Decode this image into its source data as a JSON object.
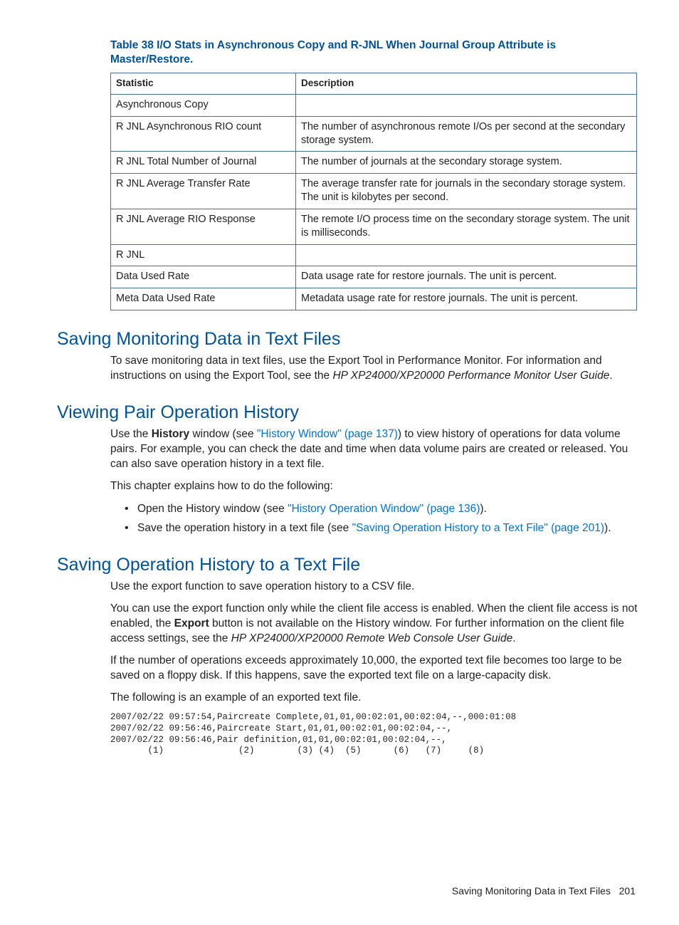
{
  "table": {
    "caption": "Table 38 I/O Stats in Asynchronous Copy and R-JNL When Journal Group Attribute is Master/Restore.",
    "headers": {
      "col1": "Statistic",
      "col2": "Description"
    },
    "rows": [
      {
        "c1": "Asynchronous Copy",
        "c2": ""
      },
      {
        "c1": "R JNL Asynchronous RIO count",
        "c2": "The number of asynchronous remote I/Os per second at the secondary storage system."
      },
      {
        "c1": "R JNL Total Number of Journal",
        "c2": "The number of journals at the secondary storage system."
      },
      {
        "c1": "R JNL Average Transfer Rate",
        "c2": "The average transfer rate for journals in the secondary storage system. The unit is kilobytes per second."
      },
      {
        "c1": "R JNL Average RIO Response",
        "c2": "The remote I/O process time on the secondary storage system. The unit is milliseconds."
      },
      {
        "c1": "R JNL",
        "c2": ""
      },
      {
        "c1": "Data Used Rate",
        "c2": "Data usage rate for restore journals. The unit is percent."
      },
      {
        "c1": "Meta Data Used Rate",
        "c2": "Metadata usage rate for restore journals. The unit is percent."
      }
    ]
  },
  "sections": {
    "s1": {
      "heading": "Saving Monitoring Data in Text Files",
      "p1a": "To save monitoring data in text files, use the Export Tool in Performance Monitor. For information and instructions on using the Export Tool, see the ",
      "p1b": "HP XP24000/XP20000 Performance Monitor User Guide",
      "p1c": "."
    },
    "s2": {
      "heading": "Viewing Pair Operation History",
      "p1a": "Use the ",
      "p1b": "History",
      "p1c": " window (see ",
      "p1d": "\"History Window\" (page 137)",
      "p1e": ") to view history of operations for data volume pairs. For example, you can check the date and time when data volume pairs are created or released. You can also save operation history in a text file.",
      "p2": "This chapter explains how to do the following:",
      "b1a": "Open the History window (see ",
      "b1b": "\"History Operation Window\" (page 136)",
      "b1c": ").",
      "b2a": "Save the operation history in a text file (see ",
      "b2b": "\"Saving Operation History to a Text File\" (page 201)",
      "b2c": ")."
    },
    "s3": {
      "heading": "Saving Operation History to a Text File",
      "p1": "Use the export function to save operation history to a CSV file.",
      "p2a": "You can use the export function only while the client file access is enabled. When the client file access is not enabled, the ",
      "p2b": "Export",
      "p2c": " button is not available on the History window. For further information on the client file access settings, see the ",
      "p2d": "HP XP24000/XP20000 Remote Web Console User Guide",
      "p2e": ".",
      "p3": "If the number of operations exceeds approximately 10,000, the exported text file becomes too large to be saved on a floppy disk. If this happens, save the exported text file on a large-capacity disk.",
      "p4": "The following is an example of an exported text file.",
      "code": "2007/02/22 09:57:54,Paircreate Complete,01,01,00:02:01,00:02:04,--,000:01:08\n2007/02/22 09:56:46,Paircreate Start,01,01,00:02:01,00:02:04,--,\n2007/02/22 09:56:46,Pair definition,01,01,00:02:01,00:02:04,--,\n       (1)              (2)        (3) (4)  (5)      (6)   (7)     (8)"
    }
  },
  "footer": {
    "label": "Saving Monitoring Data in Text Files",
    "page": "201"
  }
}
